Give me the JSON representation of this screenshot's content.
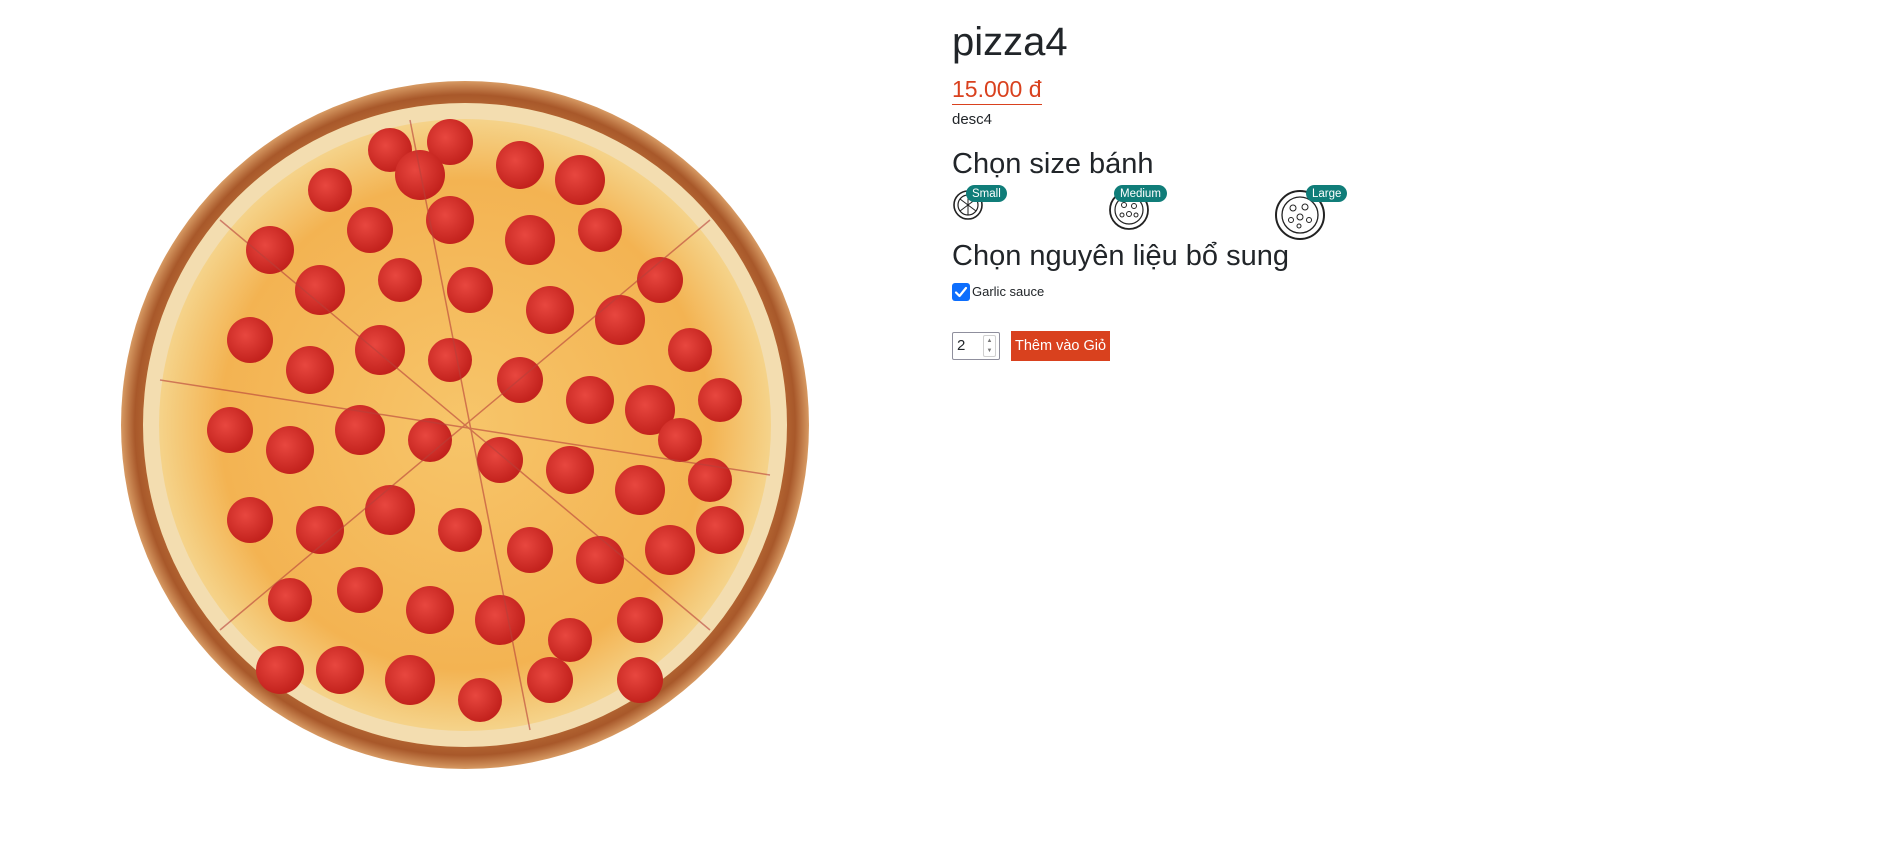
{
  "product": {
    "name": "pizza4",
    "price": "15.000 đ",
    "description": "desc4",
    "image_icon": "pepperoni-pizza-image"
  },
  "size_section": {
    "heading": "Chọn size bánh",
    "options": [
      {
        "label": "Small",
        "icon": "pizza-small-icon"
      },
      {
        "label": "Medium",
        "icon": "pizza-medium-icon"
      },
      {
        "label": "Large",
        "icon": "pizza-large-icon"
      }
    ]
  },
  "extras_section": {
    "heading": "Chọn nguyên liệu bổ sung",
    "items": [
      {
        "label": "Garlic sauce",
        "checked": true
      }
    ]
  },
  "cart": {
    "quantity": "2",
    "add_button_label": "Thêm vào Giỏ"
  },
  "colors": {
    "accent": "#d9411e",
    "badge": "#107d79",
    "checkbox": "#0d6efd"
  }
}
